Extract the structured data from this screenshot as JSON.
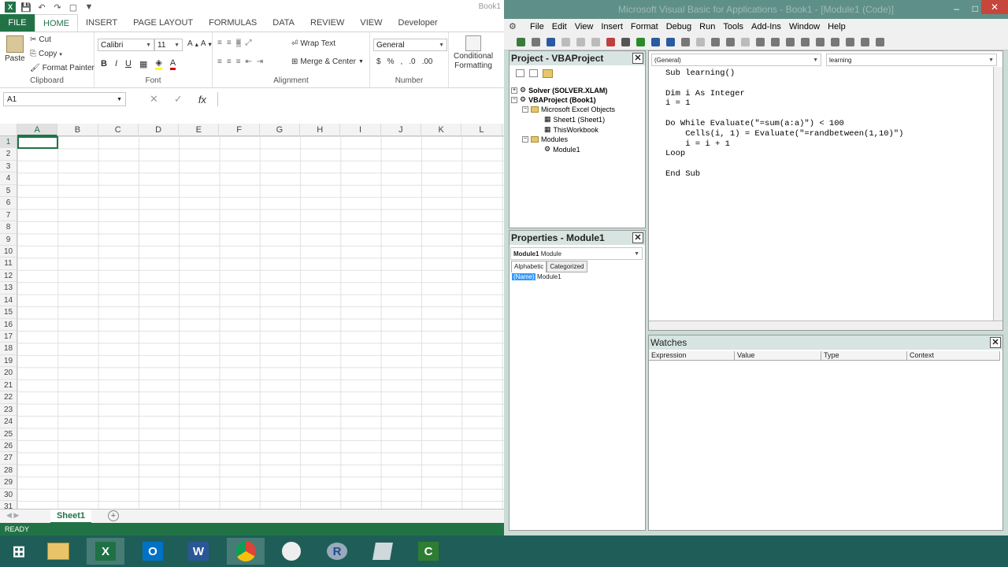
{
  "excel": {
    "window_title": "Book1",
    "tabs": [
      "FILE",
      "HOME",
      "INSERT",
      "PAGE LAYOUT",
      "FORMULAS",
      "DATA",
      "REVIEW",
      "VIEW",
      "Developer"
    ],
    "clipboard": {
      "paste": "Paste",
      "cut": "Cut",
      "copy": "Copy",
      "format_painter": "Format Painter",
      "label": "Clipboard"
    },
    "font": {
      "name": "Calibri",
      "size": "11",
      "label": "Font"
    },
    "alignment": {
      "wrap": "Wrap Text",
      "merge": "Merge & Center",
      "label": "Alignment"
    },
    "number": {
      "format": "General",
      "label": "Number"
    },
    "styles": {
      "cond": "Conditional",
      "formatting": "Formatting"
    },
    "name_box": "A1",
    "columns": [
      "A",
      "B",
      "C",
      "D",
      "E",
      "F",
      "G",
      "H",
      "I",
      "J",
      "K",
      "L"
    ],
    "rows": [
      "1",
      "2",
      "3",
      "4",
      "5",
      "6",
      "7",
      "8",
      "9",
      "10",
      "11",
      "12",
      "13",
      "14",
      "15",
      "16",
      "17",
      "18",
      "19",
      "20",
      "21",
      "22",
      "23",
      "24",
      "25",
      "26",
      "27",
      "28",
      "29",
      "30",
      "31"
    ],
    "sheet_tab": "Sheet1",
    "status": "READY"
  },
  "vbe": {
    "title": "Microsoft Visual Basic for Applications - Book1 - [Module1 (Code)]",
    "menu": [
      "File",
      "Edit",
      "View",
      "Insert",
      "Format",
      "Debug",
      "Run",
      "Tools",
      "Add-Ins",
      "Window",
      "Help"
    ],
    "project_title": "Project - VBAProject",
    "tree": {
      "solver": "Solver (SOLVER.XLAM)",
      "vbaproject": "VBAProject (Book1)",
      "excel_objects": "Microsoft Excel Objects",
      "sheet1": "Sheet1 (Sheet1)",
      "thisworkbook": "ThisWorkbook",
      "modules": "Modules",
      "module1": "Module1"
    },
    "properties_title": "Properties - Module1",
    "properties_object": "Module1",
    "properties_type": "Module",
    "prop_tabs": [
      "Alphabetic",
      "Categorized"
    ],
    "prop_name_key": "(Name)",
    "prop_name_val": "Module1",
    "general_combo": "(General)",
    "proc_combo": "learning",
    "code": [
      "Sub learning()",
      "",
      "Dim i As Integer",
      "i = 1",
      "",
      "Do While Evaluate(\"=sum(a:a)\") < 100",
      "    Cells(i, 1) = Evaluate(\"=randbetween(1,10)\")",
      "    i = i + 1",
      "Loop",
      "",
      "End Sub"
    ],
    "watches_title": "Watches",
    "watch_cols": [
      "Expression",
      "Value",
      "Type",
      "Context"
    ]
  },
  "taskbar": {
    "items": [
      "start-icon",
      "file-explorer-icon",
      "excel-icon",
      "outlook-icon",
      "word-icon",
      "chrome-icon",
      "paint-icon",
      "r-icon",
      "app-icon",
      "camtasia-icon"
    ],
    "accent": "#1f5e58"
  }
}
